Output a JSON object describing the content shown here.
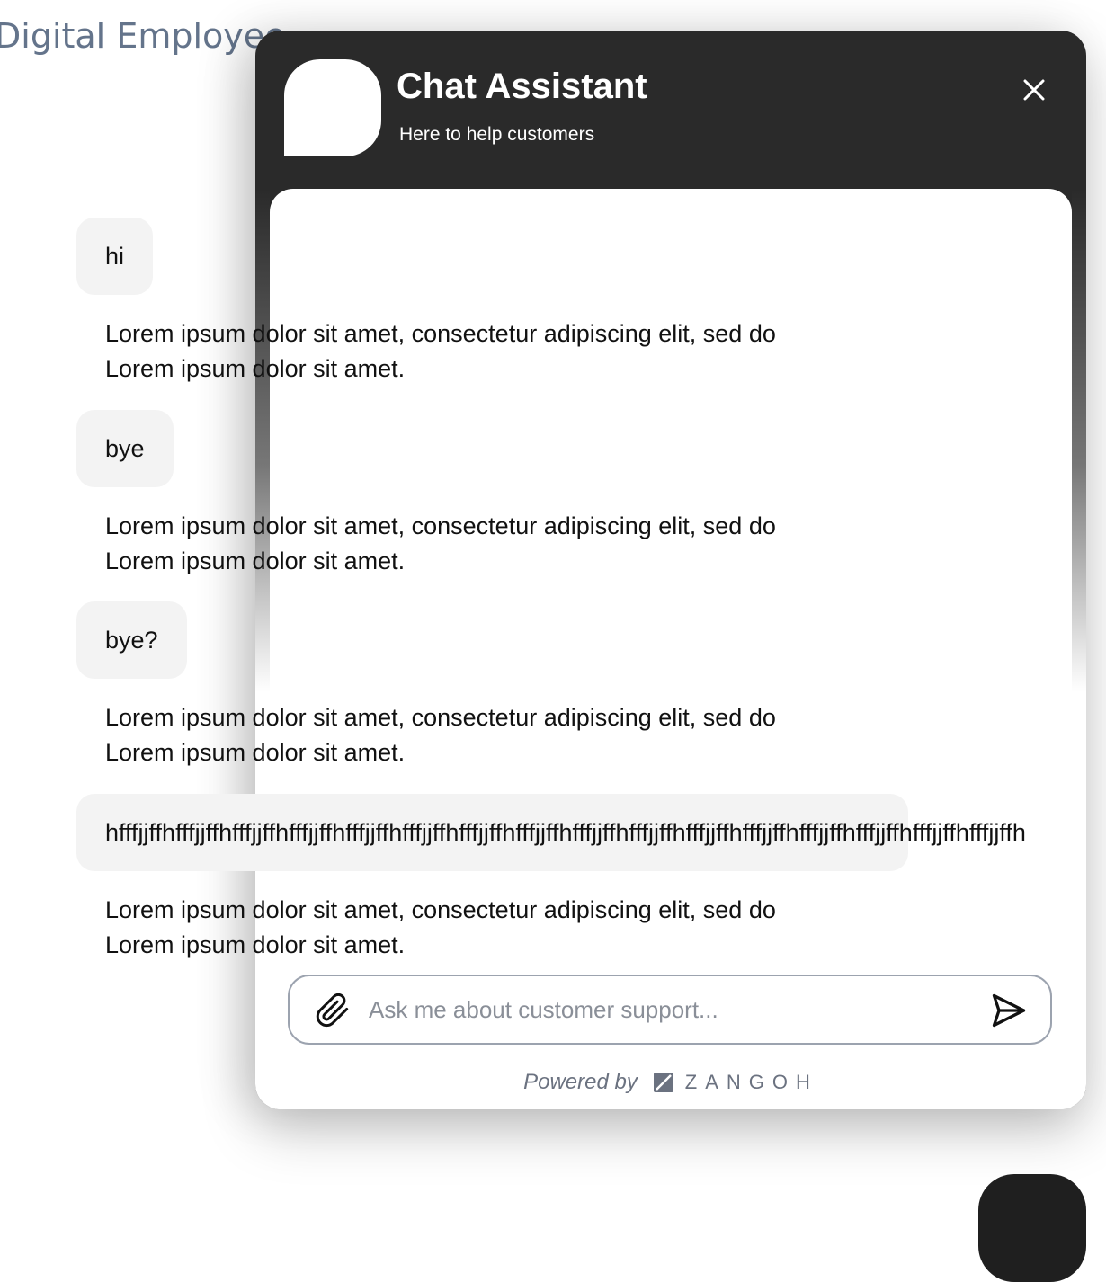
{
  "page": {
    "title": "Digital Employee"
  },
  "header": {
    "title": "Chat Assistant",
    "subtitle": "Here to help customers",
    "avatar_icon": "avatar",
    "close_icon": "close-icon"
  },
  "messages": [
    {
      "role": "user",
      "text": "hi"
    },
    {
      "role": "assistant",
      "text": "Lorem ipsum dolor sit amet, consectetur adipiscing elit, sed do\nLorem ipsum dolor sit amet."
    },
    {
      "role": "user",
      "text": "bye"
    },
    {
      "role": "assistant",
      "text": "Lorem ipsum dolor sit amet, consectetur adipiscing elit, sed do\nLorem ipsum dolor sit amet."
    },
    {
      "role": "user",
      "text": "bye?"
    },
    {
      "role": "assistant",
      "text": "Lorem ipsum dolor sit amet, consectetur adipiscing elit, sed do\nLorem ipsum dolor sit amet."
    },
    {
      "role": "user",
      "text": "hfffjjffhfffjjffhfffjjffhfffjjffhfffjjffhfffjjffhfffjjffhfffjjffhfffjjffhfffjjffhfffjjffhfffjjffhfffjjffhfffjjffhfffjjffhfffjjffh"
    },
    {
      "role": "assistant",
      "text": "Lorem ipsum dolor sit amet, consectetur adipiscing elit, sed do\nLorem ipsum dolor sit amet."
    }
  ],
  "composer": {
    "placeholder": "Ask me about customer support...",
    "value": "",
    "attach_icon": "paperclip-icon",
    "send_icon": "send-icon"
  },
  "footer": {
    "powered_by": "Powered by",
    "brand": "ZANGOH"
  },
  "colors": {
    "panel_header": "#2a2a2a",
    "user_bubble": "#f3f3f3",
    "page_title": "#64748b",
    "launcher": "#1f1f1f"
  }
}
